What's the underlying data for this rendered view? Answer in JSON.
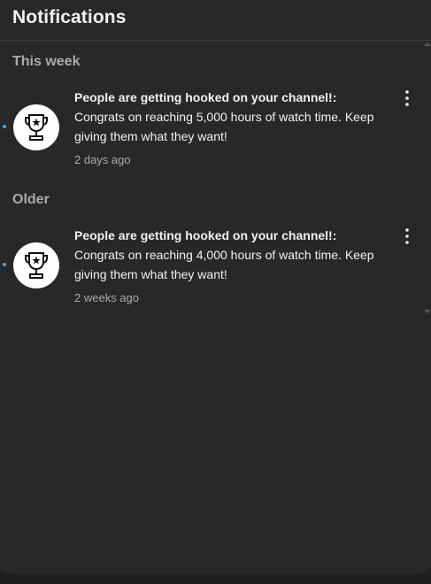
{
  "header": {
    "title": "Notifications"
  },
  "sections": [
    {
      "title": "This week",
      "items": [
        {
          "title": "People are getting hooked on your channel!",
          "separator": ":",
          "body": " Congrats on reaching 5,000 hours of watch time. Keep giving them what they want!",
          "time": "2 days ago",
          "icon": "trophy-icon",
          "unread": true
        }
      ]
    },
    {
      "title": "Older",
      "items": [
        {
          "title": "People are getting hooked on your channel!",
          "separator": ":",
          "body": " Congrats on reaching 4,000 hours of watch time. Keep giving them what they want!",
          "time": "2 weeks ago",
          "icon": "trophy-icon",
          "unread": true
        }
      ]
    }
  ],
  "colors": {
    "background": "#282828",
    "text_primary": "#f1f1f1",
    "text_secondary": "#aaaaaa",
    "unread_dot": "#3ea6ff"
  }
}
